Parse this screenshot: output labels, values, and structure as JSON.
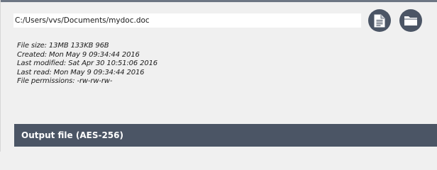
{
  "input_file": {
    "path": "C:/Users/vvs/Documents/mydoc.doc"
  },
  "buttons": {
    "open_file_icon": "document-icon",
    "open_folder_icon": "folder-icon"
  },
  "file_info": {
    "size": "File size: 13MB 133KB 96B",
    "created": "Created: Mon May 9 09:34:44 2016",
    "modified": "Last modified: Sat Apr 30 10:51:06 2016",
    "read": "Last read: Mon May 9 09:34:44 2016",
    "permissions": "File permissions: -rw-rw-rw-"
  },
  "output_section": {
    "title": "Output file (AES-256)"
  },
  "colors": {
    "accent": "#4b5565",
    "background": "#f0f0f0"
  }
}
